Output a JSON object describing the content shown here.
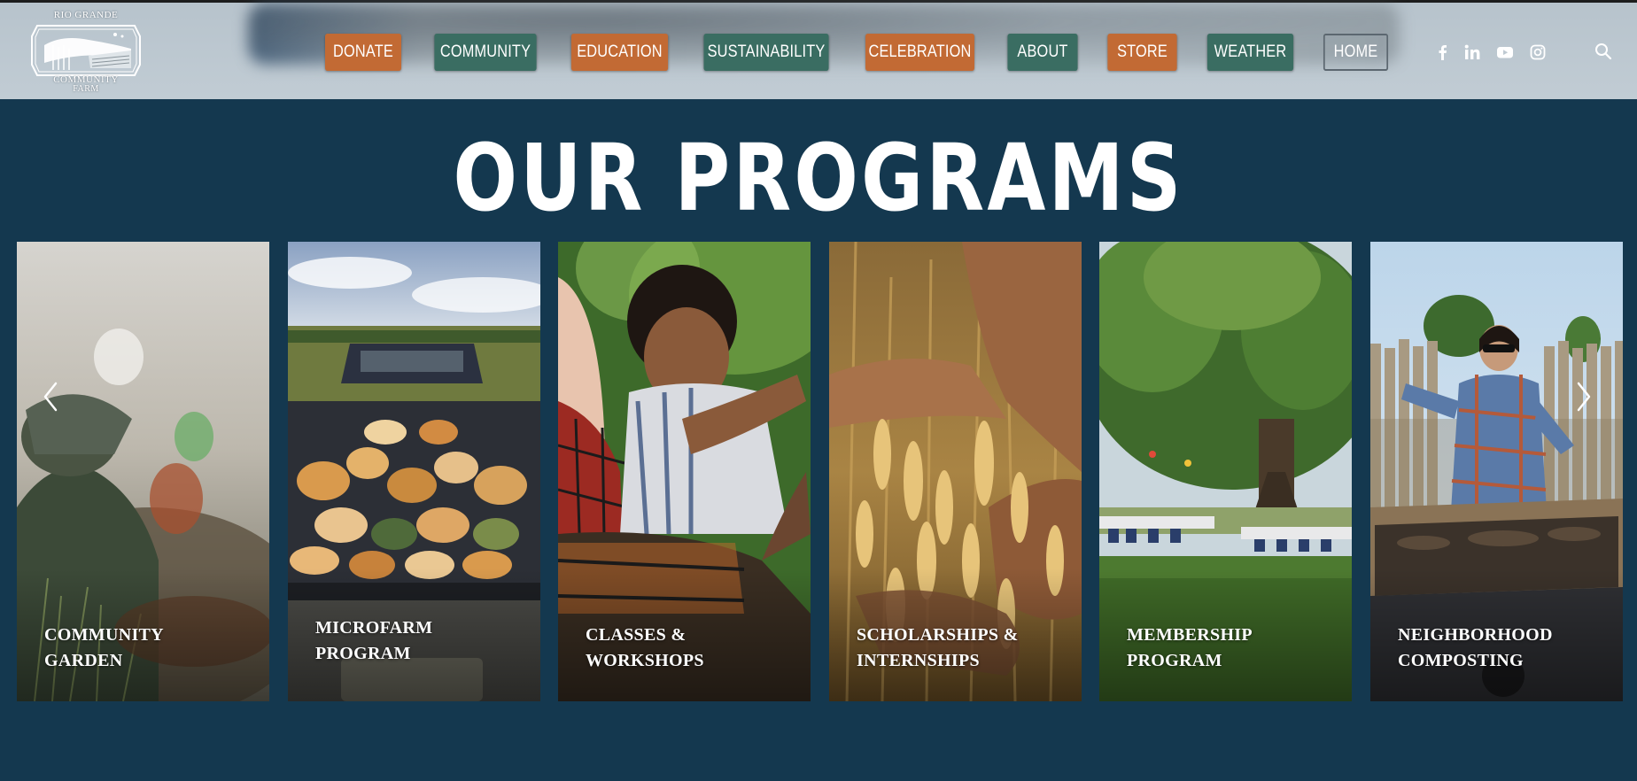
{
  "logo": {
    "top_text": "RIO GRANDE",
    "bottom_text_1": "COMMUNITY",
    "bottom_text_2": "FARM"
  },
  "nav": {
    "items": [
      {
        "label": "DONATE",
        "style": "orange"
      },
      {
        "label": "COMMUNITY",
        "style": "green"
      },
      {
        "label": "EDUCATION",
        "style": "orange"
      },
      {
        "label": "SUSTAINABILITY",
        "style": "green"
      },
      {
        "label": "CELEBRATION",
        "style": "orange"
      },
      {
        "label": "ABOUT",
        "style": "green"
      },
      {
        "label": "STORE",
        "style": "orange"
      },
      {
        "label": "WEATHER",
        "style": "green"
      },
      {
        "label": "HOME",
        "style": "outline"
      }
    ]
  },
  "social": {
    "icons": [
      "facebook-icon",
      "linkedin-icon",
      "youtube-icon",
      "instagram-icon"
    ]
  },
  "search": {
    "icon": "search-icon"
  },
  "main": {
    "title": "OUR PROGRAMS",
    "cards": [
      {
        "line1": "COMMUNITY",
        "line2": "GARDEN"
      },
      {
        "line1": "MICROFARM",
        "line2": "PROGRAM"
      },
      {
        "line1": "CLASSES &",
        "line2": "WORKSHOPS"
      },
      {
        "line1": "SCHOLARSHIPS &",
        "line2": "INTERNSHIPS"
      },
      {
        "line1": "MEMBERSHIP",
        "line2": "PROGRAM"
      },
      {
        "line1": "NEIGHBORHOOD",
        "line2": "COMPOSTING"
      }
    ],
    "prev_icon": "chevron-left-icon",
    "next_icon": "chevron-right-icon"
  },
  "colors": {
    "background": "#14384f",
    "header": "#bfcad2",
    "orange": "#c26a34",
    "green": "#3a6d62",
    "text": "#ffffff"
  }
}
